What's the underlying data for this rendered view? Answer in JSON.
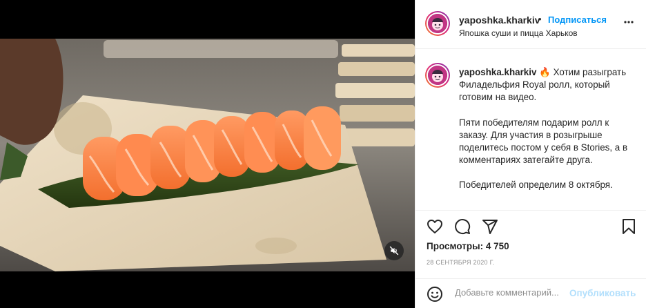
{
  "post": {
    "author": {
      "username": "yaposhka.kharkiv",
      "follow_label": "Подписаться",
      "separator": "•",
      "location": "Япошка суши и пицца Харьков",
      "avatar_icon": "sushi-chef-avatar-icon"
    },
    "caption": {
      "username": "yaposhka.kharkiv",
      "emoji": "🔥",
      "paragraphs": [
        "Хотим разыграть Филадельфия Royal ролл, который готовим на видео.",
        "Пяти победителям подарим ролл к заказу. Для участия в розыгрыше поделитесь постом у себя в Stories, а в комментариях затегайте друга.",
        "Победителей определим 8 октября."
      ]
    },
    "stats": {
      "views_label": "Просмотры:",
      "views_value": "4 750",
      "date": "28 СЕНТЯБРЯ 2020 Г."
    },
    "comment": {
      "placeholder": "Добавьте комментарий...",
      "publish_label": "Опубликовать"
    },
    "icons": {
      "like": "heart-icon",
      "comment": "comment-icon",
      "share": "send-icon",
      "save": "bookmark-icon",
      "mute": "muted-speaker-icon",
      "emoji": "smiley-icon",
      "more": "more-dots-icon"
    },
    "colors": {
      "accent": "#0095f6",
      "publish_disabled": "#b2dffc",
      "muted_text": "#8e8e8e"
    }
  }
}
